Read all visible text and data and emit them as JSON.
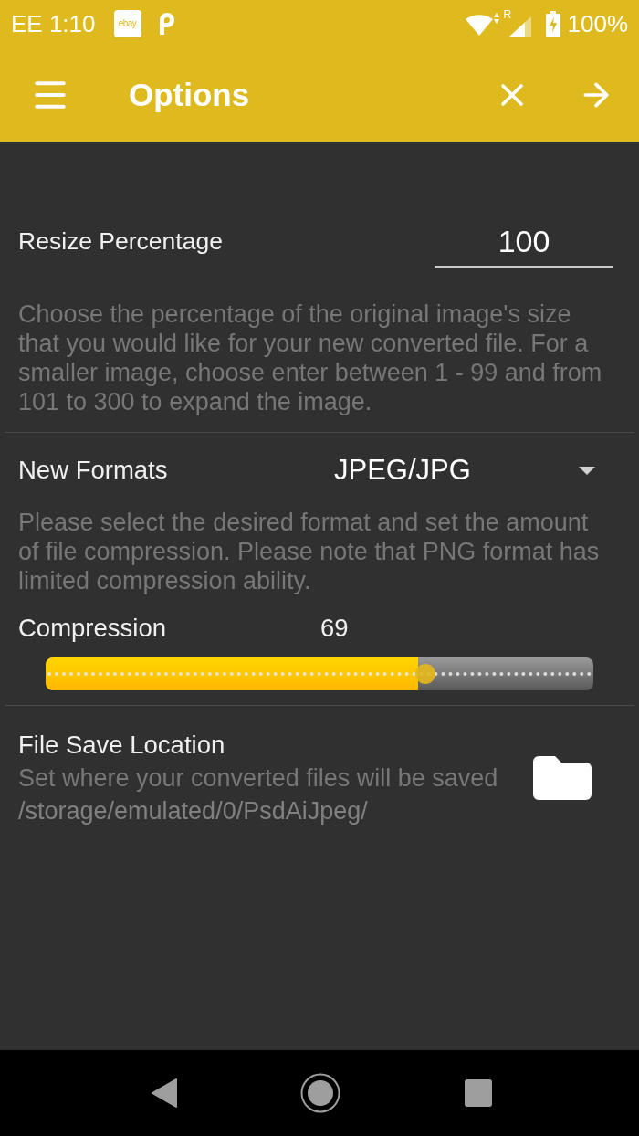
{
  "status_bar": {
    "carrier_time": "EE 1:10",
    "notification_logo": "ebay",
    "roaming": "R",
    "battery": "100%"
  },
  "toolbar": {
    "title": "Options"
  },
  "resize": {
    "label": "Resize Percentage",
    "value": "100",
    "description": "Choose the percentage of the original image's size that you would like for your new converted file. For a smaller image, choose enter between 1 - 99 and from 101 to 300 to expand the image."
  },
  "format": {
    "label": "New Formats",
    "dropdown": "JPEG/JPG",
    "description": "Please select the desired format and set the amount of file compression. Please note that PNG format has limited compression ability."
  },
  "compression": {
    "label": "Compression",
    "reading": "69",
    "level": 0.69
  },
  "save_location": {
    "label": "File Save Location",
    "description": "Set where your converted files will be saved",
    "path": "/storage/emulated/0/PsdAiJpeg/"
  }
}
